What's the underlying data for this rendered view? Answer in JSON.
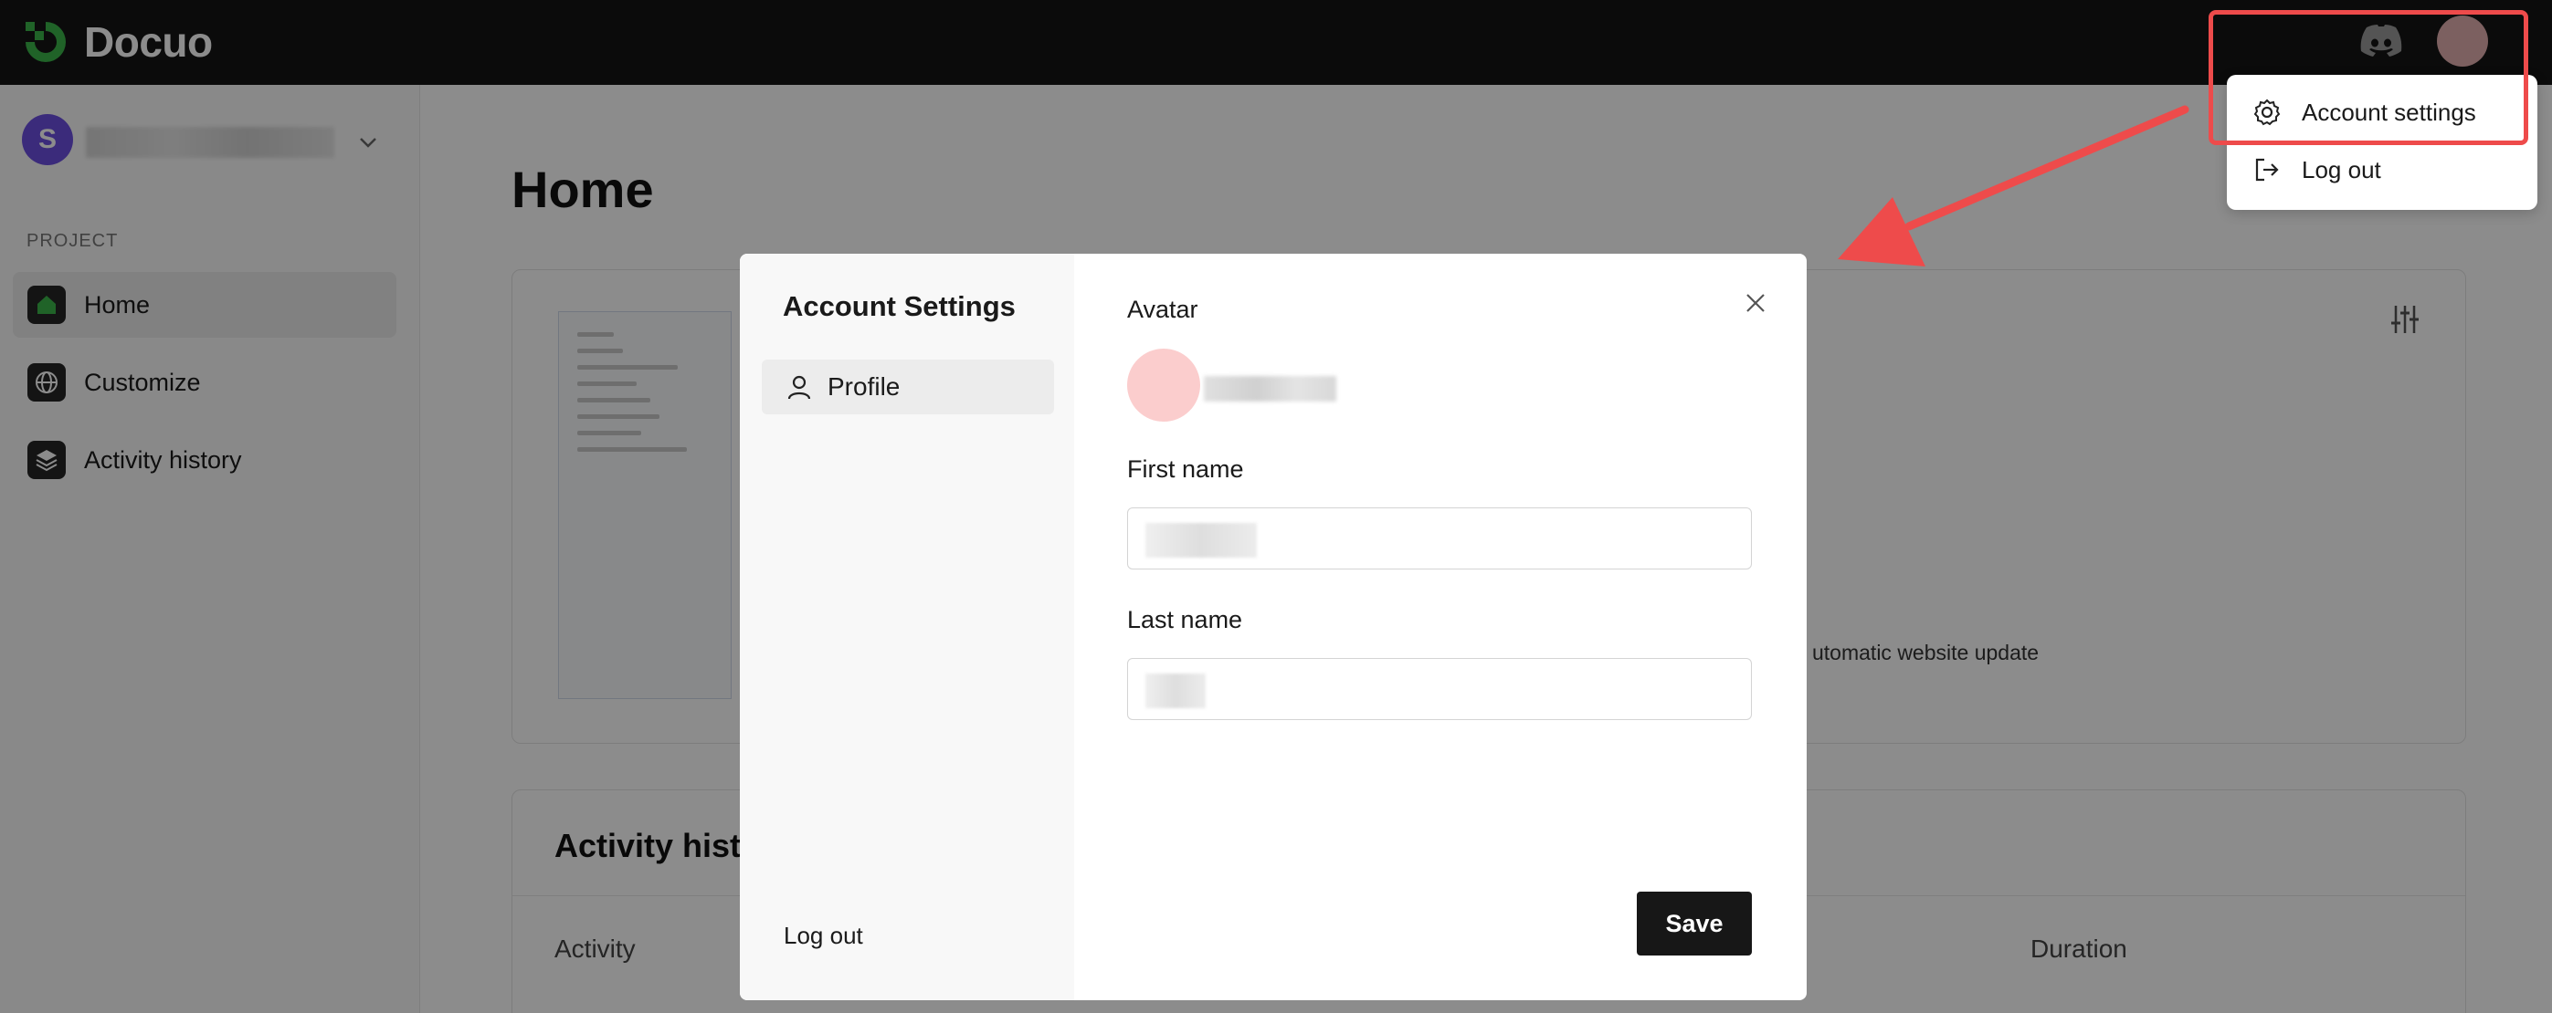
{
  "app": {
    "name": "Docuo",
    "brand_color": "#3bb54a"
  },
  "workspace": {
    "initial": "S"
  },
  "sidebar": {
    "section": "PROJECT",
    "items": [
      {
        "label": "Home",
        "icon": "home-icon",
        "active": true
      },
      {
        "label": "Customize",
        "icon": "globe-icon",
        "active": false
      },
      {
        "label": "Activity history",
        "icon": "layers-icon",
        "active": false
      }
    ]
  },
  "main": {
    "title": "Home",
    "card_text": "utomatic website update",
    "activity": {
      "title": "Activity hist",
      "columns": [
        "Activity",
        "Duration"
      ]
    }
  },
  "dropdown": {
    "items": [
      {
        "label": "Account settings",
        "icon": "gear-icon"
      },
      {
        "label": "Log out",
        "icon": "logout-icon"
      }
    ]
  },
  "modal": {
    "title": "Account Settings",
    "tab": "Profile",
    "logout": "Log out",
    "avatar_label": "Avatar",
    "first_name_label": "First name",
    "last_name_label": "Last name",
    "save_label": "Save"
  },
  "annotation_color": "#ee4b4b"
}
